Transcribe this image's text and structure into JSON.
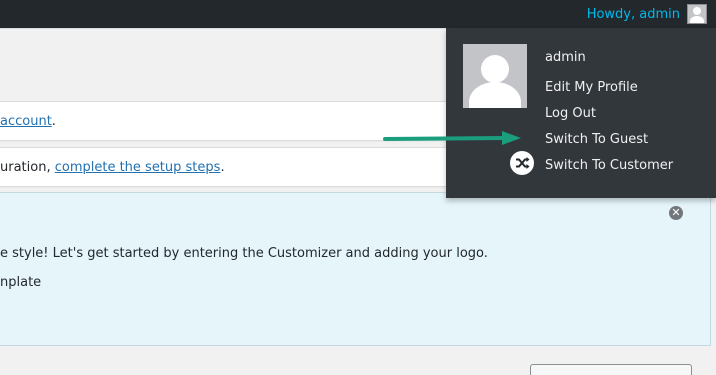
{
  "admin_bar": {
    "howdy_text": "Howdy, admin",
    "link_color": "#00b9eb"
  },
  "notices": {
    "notice1": {
      "link": "account",
      "suffix": "."
    },
    "notice2": {
      "prefix": "uration, ",
      "link": "complete the setup steps",
      "suffix": "."
    }
  },
  "welcome_panel": {
    "line1": "e style! Let's get started by entering the Customizer and adding your logo.",
    "line2": "nplate",
    "dismiss_icon": "close-icon",
    "background": "#e5f5fa"
  },
  "user_menu": {
    "display_name": "admin",
    "items": {
      "edit_profile": "Edit My Profile",
      "log_out": "Log Out",
      "switch_guest": "Switch To Guest",
      "switch_customer": "Switch To Customer"
    },
    "switch_icon": "shuffle-icon",
    "background": "#32373c"
  },
  "annotation": {
    "arrow_color": "#1a9e7e",
    "points_to": "Switch To Guest"
  }
}
